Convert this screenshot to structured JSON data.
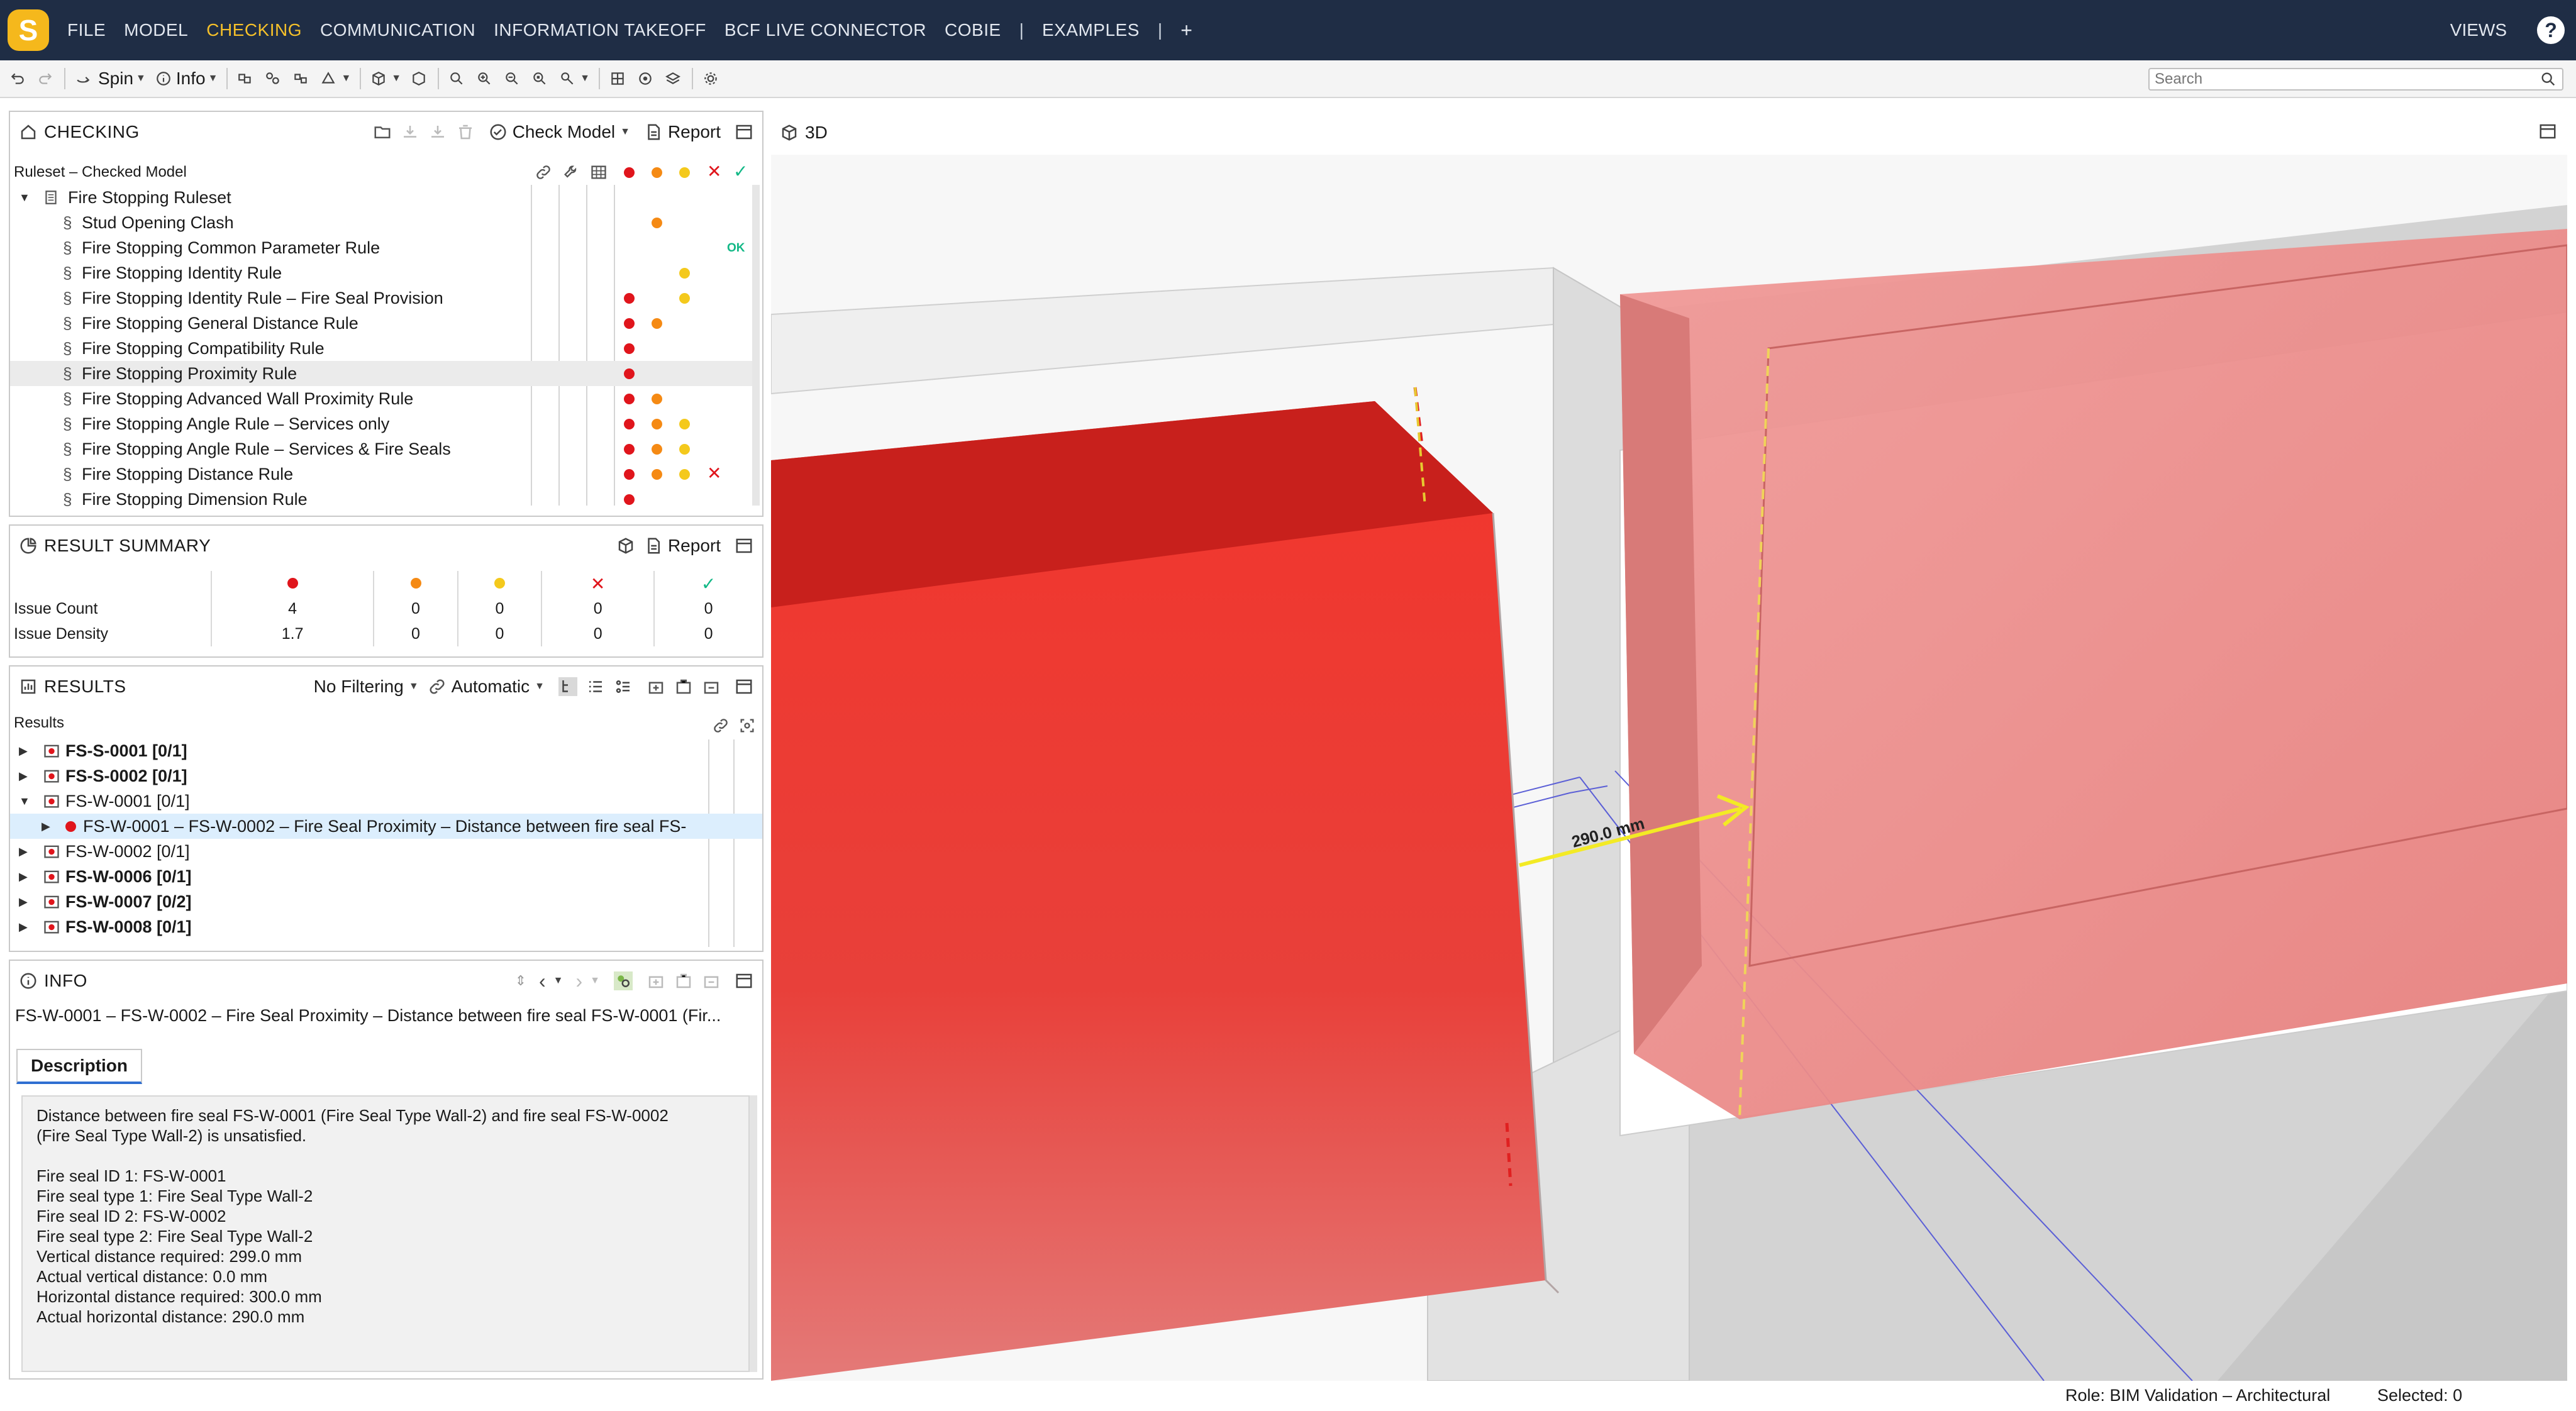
{
  "menu": {
    "logo_letter": "S",
    "items": [
      "FILE",
      "MODEL",
      "CHECKING",
      "COMMUNICATION",
      "INFORMATION TAKEOFF",
      "BCF LIVE CONNECTOR",
      "COBIE"
    ],
    "separator": "|",
    "examples": "EXAMPLES",
    "separator2": "|",
    "add": "+",
    "views": "VIEWS",
    "help": "?",
    "active_color": "#f5c02a"
  },
  "toolbar": {
    "spin_label": "Spin",
    "info_label": "Info",
    "search_placeholder": "Search"
  },
  "checking": {
    "title": "CHECKING",
    "check_model": "Check Model",
    "report": "Report",
    "ruleset_header": "Ruleset – Checked Model",
    "root": "Fire Stopping Ruleset",
    "section_symbol": "§",
    "ok_label": "OK",
    "rules": [
      {
        "label": "Stud Opening Clash",
        "issues": [
          "orange"
        ]
      },
      {
        "label": "Fire Stopping Common Parameter Rule",
        "issues": [
          "ok"
        ]
      },
      {
        "label": "Fire Stopping Identity Rule",
        "issues": [
          "yellow"
        ]
      },
      {
        "label": "Fire Stopping Identity Rule – Fire Seal Provision",
        "issues": [
          "red",
          "yellow"
        ]
      },
      {
        "label": "Fire Stopping General Distance Rule",
        "issues": [
          "red",
          "orange"
        ]
      },
      {
        "label": "Fire Stopping Compatibility Rule",
        "issues": [
          "red"
        ]
      },
      {
        "label": "Fire Stopping Proximity Rule",
        "issues": [
          "red"
        ],
        "selected": true
      },
      {
        "label": "Fire Stopping Advanced Wall Proximity Rule",
        "issues": [
          "red",
          "orange"
        ]
      },
      {
        "label": "Fire Stopping Angle Rule – Services only",
        "issues": [
          "red",
          "orange",
          "yellow"
        ]
      },
      {
        "label": "Fire Stopping Angle Rule – Services & Fire Seals",
        "issues": [
          "red",
          "orange",
          "yellow"
        ]
      },
      {
        "label": "Fire Stopping Distance Rule",
        "issues": [
          "red",
          "orange",
          "yellow",
          "x"
        ]
      },
      {
        "label": "Fire Stopping Dimension Rule",
        "issues": [
          "red"
        ]
      }
    ]
  },
  "summary": {
    "title": "RESULT SUMMARY",
    "report": "Report",
    "rows": [
      {
        "label": "Issue Count",
        "values": [
          "4",
          "0",
          "0",
          "0",
          "0"
        ]
      },
      {
        "label": "Issue Density",
        "values": [
          "1.7",
          "0",
          "0",
          "0",
          "0"
        ]
      }
    ]
  },
  "results": {
    "title": "RESULTS",
    "filter": "No Filtering",
    "mode": "Automatic",
    "sub_label": "Results",
    "items": [
      {
        "text": "FS-S-0001 [0/1]",
        "bold": true,
        "expanded": false
      },
      {
        "text": "FS-S-0002 [0/1]",
        "bold": true,
        "expanded": false
      },
      {
        "text": "FS-W-0001 [0/1]",
        "bold": false,
        "expanded": true
      },
      {
        "text": "FS-W-0001 – FS-W-0002 – Fire Seal Proximity – Distance between fire seal FS-",
        "bold": false,
        "child": true,
        "selected": true
      },
      {
        "text": "FS-W-0002 [0/1]",
        "bold": false,
        "expanded": false
      },
      {
        "text": "FS-W-0006 [0/1]",
        "bold": true,
        "expanded": false
      },
      {
        "text": "FS-W-0007 [0/2]",
        "bold": true,
        "expanded": false
      },
      {
        "text": "FS-W-0008 [0/1]",
        "bold": true,
        "expanded": false
      }
    ]
  },
  "info": {
    "title": "INFO",
    "heading": "FS-W-0001 – FS-W-0002 – Fire Seal Proximity – Distance between fire seal FS-W-0001 (Fir...",
    "tab": "Description",
    "description": "Distance between fire seal FS-W-0001 (Fire Seal Type Wall-2) and fire seal FS-W-0002\n(Fire Seal Type Wall-2) is unsatisfied.\n\nFire seal ID 1: FS-W-0001\nFire seal type 1: Fire Seal Type Wall-2\nFire seal ID 2: FS-W-0002\nFire seal type 2: Fire Seal Type Wall-2\nVertical distance required: 299.0 mm\nActual vertical distance: 0.0 mm\nHorizontal distance required: 300.0 mm\nActual horizontal distance: 290.0 mm\n\n\nLocation:"
  },
  "view3d": {
    "title": "3D",
    "dimension_label": "290.0 mm"
  },
  "status": {
    "role": "Role: BIM Validation – Architectural",
    "selected": "Selected: 0"
  },
  "colors": {
    "menubar": "#1f2d45",
    "issue_red": "#e0151c",
    "issue_orange": "#f58a14",
    "issue_yellow": "#f4c91c",
    "ok_green": "#12b886"
  }
}
